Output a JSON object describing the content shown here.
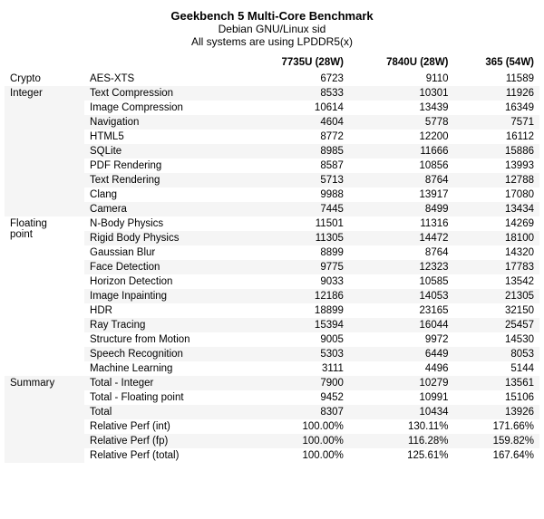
{
  "header": {
    "line1": "Geekbench 5 Multi-Core Benchmark",
    "line2": "Debian GNU/Linux sid",
    "line3": "All systems are using LPDDR5(x)"
  },
  "columns": {
    "col1": "7735U (28W)",
    "col2": "7840U (28W)",
    "col3": "365 (54W)"
  },
  "rows": [
    {
      "category": "Crypto",
      "label": "AES-XTS",
      "v1": "6723",
      "v2": "9110",
      "v3": "11589"
    },
    {
      "category": "Integer",
      "label": "Text Compression",
      "v1": "8533",
      "v2": "10301",
      "v3": "11926"
    },
    {
      "category": "",
      "label": "Image Compression",
      "v1": "10614",
      "v2": "13439",
      "v3": "16349"
    },
    {
      "category": "",
      "label": "Navigation",
      "v1": "4604",
      "v2": "5778",
      "v3": "7571"
    },
    {
      "category": "",
      "label": "HTML5",
      "v1": "8772",
      "v2": "12200",
      "v3": "16112"
    },
    {
      "category": "",
      "label": "SQLite",
      "v1": "8985",
      "v2": "11666",
      "v3": "15886"
    },
    {
      "category": "",
      "label": "PDF Rendering",
      "v1": "8587",
      "v2": "10856",
      "v3": "13993"
    },
    {
      "category": "",
      "label": "Text Rendering",
      "v1": "5713",
      "v2": "8764",
      "v3": "12788"
    },
    {
      "category": "",
      "label": "Clang",
      "v1": "9988",
      "v2": "13917",
      "v3": "17080"
    },
    {
      "category": "",
      "label": "Camera",
      "v1": "7445",
      "v2": "8499",
      "v3": "13434"
    },
    {
      "category": "Floating\npoint",
      "label": "N-Body Physics",
      "v1": "11501",
      "v2": "11316",
      "v3": "14269"
    },
    {
      "category": "",
      "label": "Rigid Body Physics",
      "v1": "11305",
      "v2": "14472",
      "v3": "18100"
    },
    {
      "category": "",
      "label": "Gaussian Blur",
      "v1": "8899",
      "v2": "8764",
      "v3": "14320"
    },
    {
      "category": "",
      "label": "Face Detection",
      "v1": "9775",
      "v2": "12323",
      "v3": "17783"
    },
    {
      "category": "",
      "label": "Horizon Detection",
      "v1": "9033",
      "v2": "10585",
      "v3": "13542"
    },
    {
      "category": "",
      "label": "Image Inpainting",
      "v1": "12186",
      "v2": "14053",
      "v3": "21305"
    },
    {
      "category": "",
      "label": "HDR",
      "v1": "18899",
      "v2": "23165",
      "v3": "32150"
    },
    {
      "category": "",
      "label": "Ray Tracing",
      "v1": "15394",
      "v2": "16044",
      "v3": "25457"
    },
    {
      "category": "",
      "label": "Structure from Motion",
      "v1": "9005",
      "v2": "9972",
      "v3": "14530"
    },
    {
      "category": "",
      "label": "Speech Recognition",
      "v1": "5303",
      "v2": "6449",
      "v3": "8053"
    },
    {
      "category": "",
      "label": "Machine Learning",
      "v1": "3111",
      "v2": "4496",
      "v3": "5144"
    },
    {
      "category": "Summary",
      "label": "Total - Integer",
      "v1": "7900",
      "v2": "10279",
      "v3": "13561"
    },
    {
      "category": "",
      "label": "Total - Floating point",
      "v1": "9452",
      "v2": "10991",
      "v3": "15106"
    },
    {
      "category": "",
      "label": "Total",
      "v1": "8307",
      "v2": "10434",
      "v3": "13926"
    },
    {
      "category": "",
      "label": "Relative Perf (int)",
      "v1": "100.00%",
      "v2": "130.11%",
      "v3": "171.66%"
    },
    {
      "category": "",
      "label": "Relative Perf (fp)",
      "v1": "100.00%",
      "v2": "116.28%",
      "v3": "159.82%"
    },
    {
      "category": "",
      "label": "Relative Perf (total)",
      "v1": "100.00%",
      "v2": "125.61%",
      "v3": "167.64%"
    }
  ]
}
